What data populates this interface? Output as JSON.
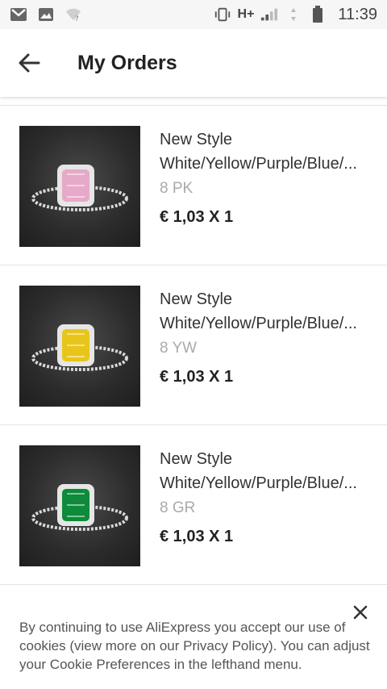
{
  "status_bar": {
    "network": "H+",
    "time": "11:39"
  },
  "header": {
    "title": "My Orders"
  },
  "orders": [
    {
      "name_line1": "New Style",
      "name_line2": "White/Yellow/Purple/Blue/...",
      "sku": "8 PK",
      "price": "€ 1,03 X 1",
      "gem_color": "#e7a9c8"
    },
    {
      "name_line1": "New Style",
      "name_line2": "White/Yellow/Purple/Blue/...",
      "sku": "8 YW",
      "price": "€ 1,03 X 1",
      "gem_color": "#e8c51a"
    },
    {
      "name_line1": "New Style",
      "name_line2": "White/Yellow/Purple/Blue/...",
      "sku": "8 GR",
      "price": "€ 1,03 X 1",
      "gem_color": "#0d8a3a"
    }
  ],
  "cookie_banner": {
    "text": "By continuing to use AliExpress you accept our use of cookies (view more on our Privacy Policy). You can adjust your Cookie Preferences in the lefthand menu."
  }
}
